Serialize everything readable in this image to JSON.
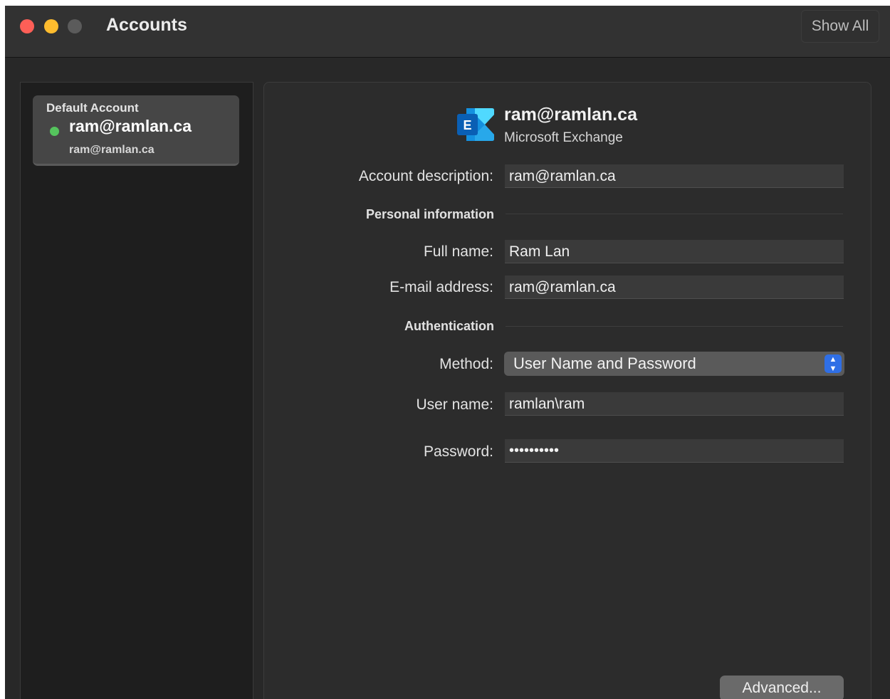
{
  "window": {
    "title": "Accounts",
    "show_all_label": "Show All"
  },
  "sidebar": {
    "accounts": [
      {
        "category": "Default Account",
        "name": "ram@ramlan.ca",
        "email": "ram@ramlan.ca",
        "status": "online"
      }
    ]
  },
  "account": {
    "display_name": "ram@ramlan.ca",
    "type": "Microsoft Exchange",
    "icon": "exchange-logo-icon"
  },
  "form": {
    "description_label": "Account description:",
    "description_value": "ram@ramlan.ca",
    "personal_section": "Personal information",
    "full_name_label": "Full name:",
    "full_name_value": "Ram Lan",
    "email_label": "E-mail address:",
    "email_value": "ram@ramlan.ca",
    "auth_section": "Authentication",
    "method_label": "Method:",
    "method_value": "User Name and Password",
    "username_label": "User name:",
    "username_value": "ramlan\\ram",
    "password_label": "Password:",
    "password_value": "••••••••••",
    "advanced_label": "Advanced..."
  },
  "colors": {
    "close": "#fe5f57",
    "minimize": "#febc2e",
    "status_online": "#55c45d",
    "select_accent": "#2f6fe6"
  }
}
